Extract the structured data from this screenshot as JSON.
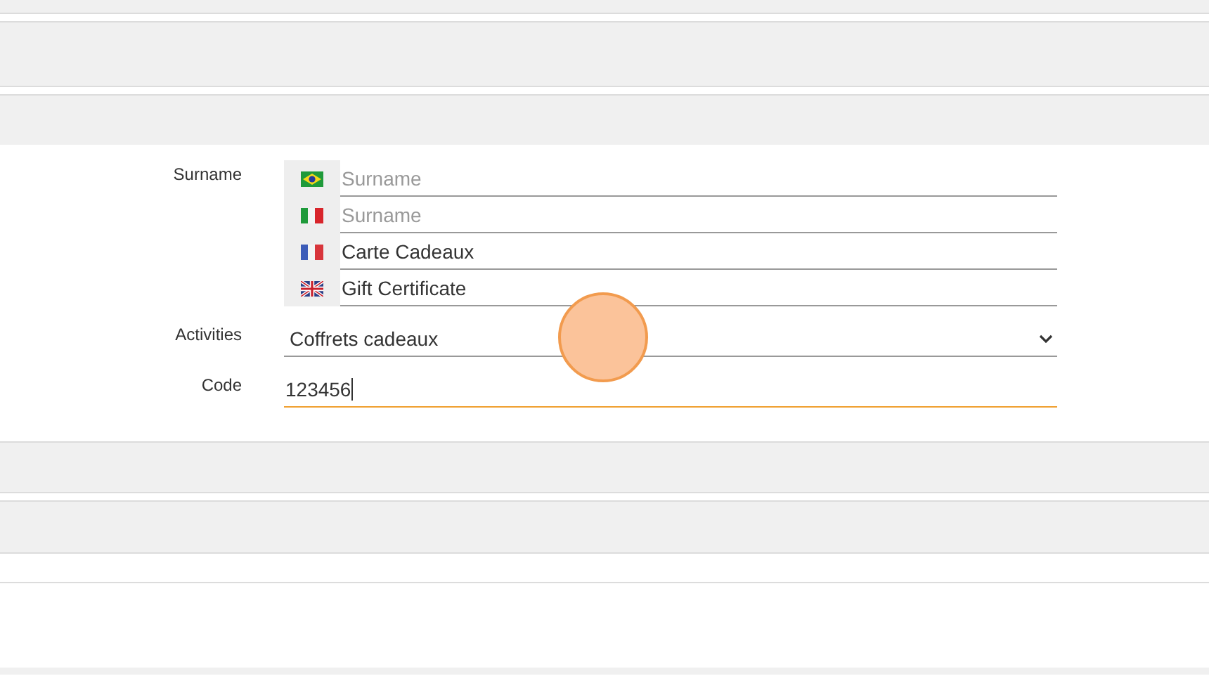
{
  "form": {
    "surname": {
      "label": "Surname",
      "translations": [
        {
          "kind": "brazil",
          "placeholder": "Surname"
        },
        {
          "kind": "italy",
          "placeholder": "Surname"
        },
        {
          "kind": "france",
          "value": "Carte Cadeaux"
        },
        {
          "kind": "britain",
          "value": "Gift Certificate"
        }
      ]
    },
    "activities": {
      "label": "Activities",
      "value": "Coffrets cadeaux"
    },
    "code": {
      "label": "Code",
      "value": "123456",
      "focused": true
    }
  }
}
